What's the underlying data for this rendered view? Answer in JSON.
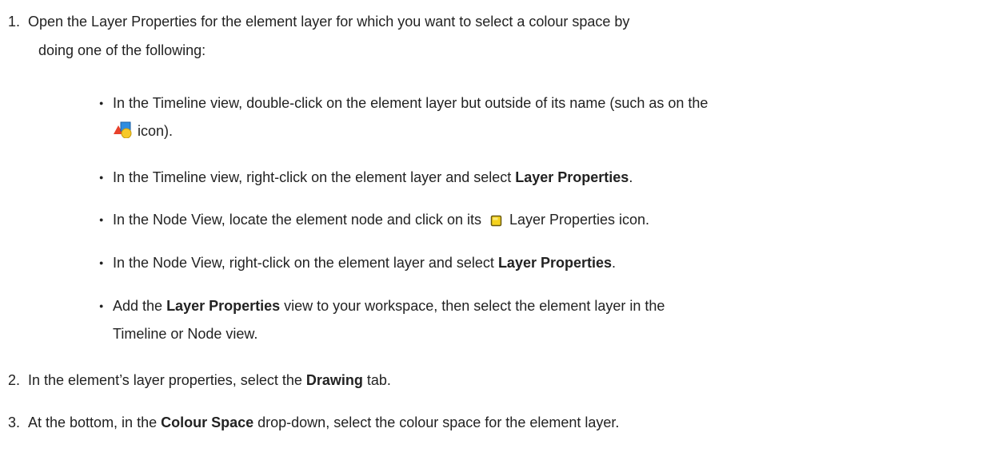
{
  "steps": [
    {
      "number": "1.",
      "line1": "Open the Layer Properties for the element layer for which you want to select a colour space by",
      "line2": "doing one of the following:"
    },
    {
      "number": "2.",
      "pre": "In the element’s layer properties, select the ",
      "bold": "Drawing",
      "post": " tab."
    },
    {
      "number": "3.",
      "pre": "At the bottom, in the ",
      "bold": "Colour Space",
      "post": " drop-down, select the colour space for the element layer."
    }
  ],
  "bullets": [
    {
      "line1": "In the Timeline view, double-click on the element layer but outside of its name (such as on the",
      "icon": "element-layer-icon",
      "line2_post": " icon)."
    },
    {
      "pre": "In the Timeline view, right-click on the element layer and select ",
      "bold": "Layer Properties",
      "post": "."
    },
    {
      "pre": "In the Node View, locate the element node and click on its ",
      "icon": "layer-properties-icon",
      "post": " Layer Properties icon."
    },
    {
      "pre": "In the Node View, right-click on the element layer and select ",
      "bold": "Layer Properties",
      "post": "."
    },
    {
      "pre": "Add the ",
      "bold": "Layer Properties",
      "post": " view to your workspace, then select the element layer in the",
      "line2": "Timeline or Node view."
    }
  ],
  "bullet_glyph": "●",
  "colors": {
    "text": "#222222",
    "icon_triangle": "#e8412b",
    "icon_square": "#2e8de0",
    "icon_circle": "#f7c928",
    "layer_props_fill": "#f5d21e",
    "layer_props_stroke": "#6a5a10"
  }
}
